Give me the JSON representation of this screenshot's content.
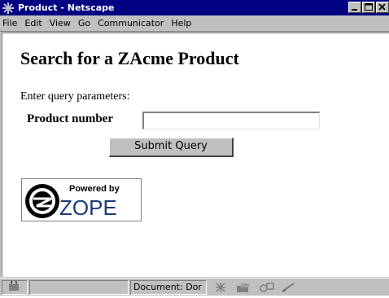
{
  "window": {
    "title": "Product - Netscape",
    "icons": {
      "app": "netscape-icon",
      "minimize": "minimize-icon",
      "maximize": "maximize-icon",
      "close": "close-icon"
    }
  },
  "menubar": {
    "items": [
      "File",
      "Edit",
      "View",
      "Go",
      "Communicator",
      "Help"
    ]
  },
  "page": {
    "title": "Search for a ZAcme Product",
    "prompt": "Enter query parameters:",
    "product_label": "Product number",
    "product_value": "",
    "submit_label": "Submit Query",
    "logo": {
      "small_text": "Powered by",
      "big_text": "ZOPE",
      "icon": "zope-logo-icon"
    }
  },
  "statusbar": {
    "status_text": "Document: Dor",
    "icons": [
      "security-lock-icon",
      "network-icon",
      "mail-icon",
      "discussion-icon",
      "composer-icon"
    ]
  },
  "colors": {
    "titlebar": "#000080",
    "chrome": "#c0c0c0",
    "page_bg": "#ffffff"
  }
}
